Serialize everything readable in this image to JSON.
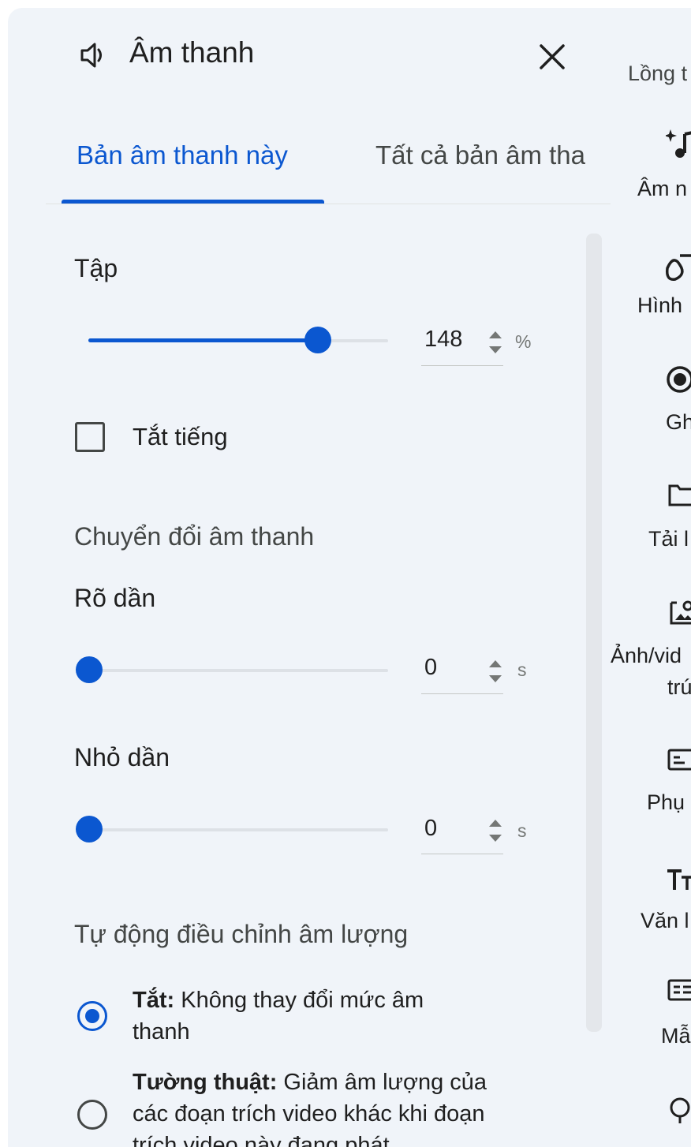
{
  "header": {
    "title": "Âm thanh",
    "icon": "speaker-icon",
    "close_icon": "close-icon"
  },
  "tabs": [
    {
      "label": "Bản âm thanh này",
      "active": true
    },
    {
      "label": "Tất cả bản âm tha",
      "active": false
    }
  ],
  "volume": {
    "label": "Tập",
    "value": "148",
    "unit": "%",
    "level_fraction": 0.74
  },
  "mute": {
    "label": "Tắt tiếng",
    "checked": false
  },
  "transition": {
    "heading": "Chuyển đổi âm thanh",
    "fade_in": {
      "label": "Rõ dần",
      "value": "0",
      "unit": "s",
      "level_fraction": 0
    },
    "fade_out": {
      "label": "Nhỏ dần",
      "value": "0",
      "unit": "s",
      "level_fraction": 0
    }
  },
  "auto_volume": {
    "heading": "Tự động điều chỉnh âm lượng",
    "options": [
      {
        "title": "Tắt:",
        "desc": "Không thay đổi mức âm thanh",
        "selected": true
      },
      {
        "title": "Tường thuật:",
        "desc": "Giảm âm lượng của các đoạn trích video khác khi đoạn trích video này đang phát",
        "selected": false
      }
    ]
  },
  "rail": {
    "top_label": "Lồng t",
    "items": [
      {
        "label": "Âm n",
        "icon": "music-sparkle-icon"
      },
      {
        "label": "Hình",
        "icon": "shapes-icon"
      },
      {
        "label": "Gh",
        "icon": "record-icon"
      },
      {
        "label": "Tải l",
        "icon": "folder-icon"
      },
      {
        "label": "Ảnh/vid",
        "label2": "trú",
        "icon": "image-icon"
      },
      {
        "label": "Phụ",
        "icon": "subtitles-icon"
      },
      {
        "label": "Văn l",
        "icon": "text-icon"
      },
      {
        "label": "Mẫ",
        "icon": "template-icon"
      }
    ]
  },
  "colors": {
    "accent": "#0b57d0",
    "panel_bg": "#f0f4f9",
    "text": "#1f1f1f"
  }
}
